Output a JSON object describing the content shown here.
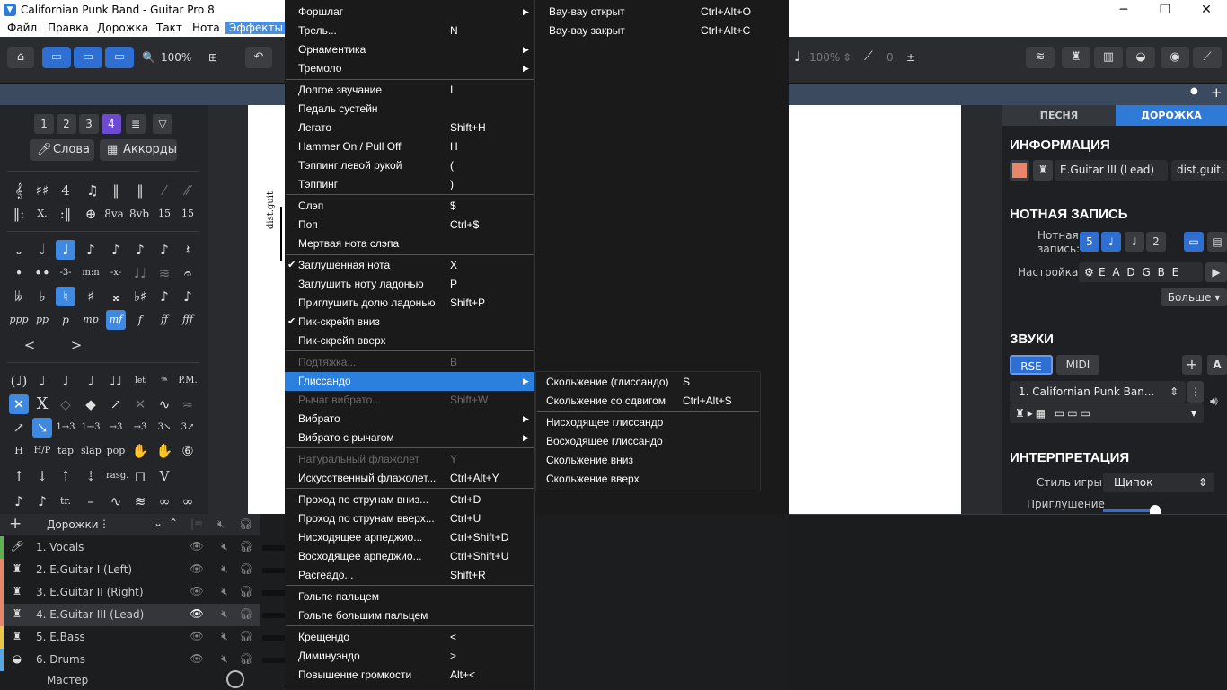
{
  "window": {
    "title": "Californian Punk Band - Guitar Pro 8"
  },
  "menubar": [
    "Файл",
    "Правка",
    "Дорожка",
    "Такт",
    "Нота",
    "Эффекты"
  ],
  "toolbar": {
    "zoom": "100%",
    "volume": "100%",
    "pick": "0"
  },
  "palette": {
    "voices": [
      "1",
      "2",
      "3",
      "4"
    ],
    "lyrics_label": "Слова",
    "chords_label": "Аккорды"
  },
  "score": {
    "staff_label": "dist.guit."
  },
  "inspector": {
    "tab_song": "ПЕСНЯ",
    "tab_track": "ДОРОЖКА",
    "info_head": "ИНФОРМАЦИЯ",
    "track_name": "E.Guitar III (Lead)",
    "short_name": "dist.guit.",
    "notation_head": "НОТНАЯ ЗАПИСЬ",
    "notation_label_1": "Нотная",
    "notation_label_2": "запись:",
    "tuning_label": "Настройка:",
    "tuning_value": "E A D G B E",
    "more_label": "Больше",
    "sounds_head": "ЗВУКИ",
    "rse_label": "RSE",
    "midi_label": "MIDI",
    "sound_name": "1. Californian Punk Ban...",
    "interp_head": "ИНТЕРПРЕТАЦИЯ",
    "style_label": "Стиль игры:",
    "style_value": "Щипок",
    "mute_label": "Приглушение"
  },
  "tracks": {
    "header_label": "Дорожки",
    "items": [
      {
        "name": "1. Vocals",
        "color": "#5fb04f"
      },
      {
        "name": "2. E.Guitar I (Left)",
        "color": "#e8866a"
      },
      {
        "name": "3. E.Guitar II (Right)",
        "color": "#e8866a"
      },
      {
        "name": "4. E.Guitar III (Lead)",
        "color": "#e8866a"
      },
      {
        "name": "5. E.Bass",
        "color": "#e6c94b"
      },
      {
        "name": "6. Drums",
        "color": "#58a6e0"
      }
    ],
    "master_label": "Мастер"
  },
  "menu_main": {
    "items": [
      {
        "label": "Форшлаг",
        "shortcut": "",
        "submenu": true
      },
      {
        "label": "Трель...",
        "shortcut": "N"
      },
      {
        "label": "Орнаментика",
        "shortcut": "",
        "submenu": true
      },
      {
        "label": "Тремоло",
        "shortcut": "",
        "submenu": true
      },
      {
        "label": "Долгое звучание",
        "shortcut": "I"
      },
      {
        "label": "Педаль сустейн",
        "shortcut": ""
      },
      {
        "label": "Легато",
        "shortcut": "Shift+H"
      },
      {
        "label": "Hammer On / Pull Off",
        "shortcut": "H"
      },
      {
        "label": "Тэппинг левой рукой",
        "shortcut": "("
      },
      {
        "label": "Тэппинг",
        "shortcut": ")"
      },
      {
        "label": "Слэп",
        "shortcut": "$"
      },
      {
        "label": "Поп",
        "shortcut": "Ctrl+$"
      },
      {
        "label": "Мертвая нота слэпа",
        "shortcut": ""
      },
      {
        "label": "Заглушенная нота",
        "shortcut": "X",
        "checked": true
      },
      {
        "label": "Заглушить ноту ладонью",
        "shortcut": "P"
      },
      {
        "label": "Приглушить долю ладонью",
        "shortcut": "Shift+P"
      },
      {
        "label": "Пик-скрейп вниз",
        "shortcut": "",
        "checked": true
      },
      {
        "label": "Пик-скрейп вверх",
        "shortcut": ""
      },
      {
        "label": "Подтяжка...",
        "shortcut": "B",
        "disabled": true
      },
      {
        "label": "Глиссандо",
        "shortcut": "",
        "submenu": true,
        "highlighted": true
      },
      {
        "label": "Рычаг вибрато...",
        "shortcut": "Shift+W",
        "disabled": true
      },
      {
        "label": "Вибрато",
        "shortcut": "",
        "submenu": true
      },
      {
        "label": "Вибрато с рычагом",
        "shortcut": "",
        "submenu": true
      },
      {
        "label": "Натуральный флажолет",
        "shortcut": "Y",
        "disabled": true
      },
      {
        "label": "Искусственный флажолет...",
        "shortcut": "Ctrl+Alt+Y"
      },
      {
        "label": "Проход по струнам вниз...",
        "shortcut": "Ctrl+D"
      },
      {
        "label": "Проход по струнам вверх...",
        "shortcut": "Ctrl+U"
      },
      {
        "label": "Нисходящее арпеджио...",
        "shortcut": "Ctrl+Shift+D"
      },
      {
        "label": "Восходящее арпеджио...",
        "shortcut": "Ctrl+Shift+U"
      },
      {
        "label": "Расгеадо...",
        "shortcut": "Shift+R"
      },
      {
        "label": "Гольпе пальцем",
        "shortcut": ""
      },
      {
        "label": "Гольпе большим пальцем",
        "shortcut": ""
      },
      {
        "label": "Крещендо",
        "shortcut": "<"
      },
      {
        "label": "Диминуэндо",
        "shortcut": ">"
      },
      {
        "label": "Повышение громкости",
        "shortcut": "Alt+<"
      }
    ]
  },
  "menu_wah": {
    "items": [
      {
        "label": "Вау-вау открыт",
        "shortcut": "Ctrl+Alt+O"
      },
      {
        "label": "Вау-вау закрыт",
        "shortcut": "Ctrl+Alt+C"
      }
    ]
  },
  "menu_gliss": {
    "items": [
      {
        "label": "Скольжение (глиссандо)",
        "shortcut": "S"
      },
      {
        "label": "Скольжение со сдвигом",
        "shortcut": "Ctrl+Alt+S"
      },
      {
        "label": "Нисходящее глиссандо",
        "shortcut": ""
      },
      {
        "label": "Восходящее глиссандо",
        "shortcut": ""
      },
      {
        "label": "Скольжение вниз",
        "shortcut": ""
      },
      {
        "label": "Скольжение вверх",
        "shortcut": ""
      }
    ]
  }
}
